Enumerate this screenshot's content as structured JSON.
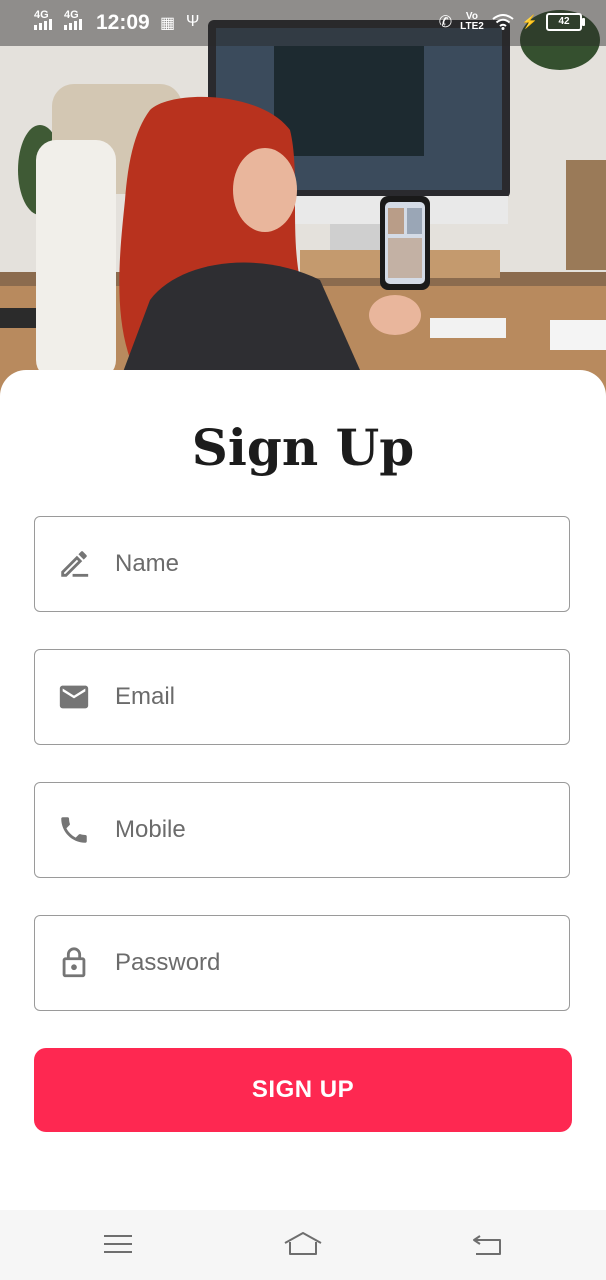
{
  "status_bar": {
    "network_1": "4G",
    "network_2": "4G",
    "time": "12:09",
    "lte_top": "Vo",
    "lte_bottom": "LTE2",
    "battery": "42",
    "icons": [
      "signal-icon",
      "signal-icon",
      "data-saver-icon",
      "usb-icon",
      "volte-icon",
      "wifi-icon",
      "charging-icon",
      "battery-icon"
    ]
  },
  "hero_image": {
    "description_icon": "hero-photo"
  },
  "form": {
    "title": "Sign Up",
    "fields": [
      {
        "placeholder": "Name",
        "icon": "pencil-icon"
      },
      {
        "placeholder": "Email",
        "icon": "email-icon"
      },
      {
        "placeholder": "Mobile",
        "icon": "phone-icon"
      },
      {
        "placeholder": "Password",
        "icon": "lock-icon"
      }
    ],
    "submit_label": "SIGN UP"
  },
  "colors": {
    "accent": "#fe2851",
    "field_border": "#9a9a9a",
    "icon_gray": "#757575",
    "title": "#1c1c1c"
  },
  "nav_bar": {
    "icons": [
      "menu-icon",
      "home-icon",
      "back-icon"
    ]
  }
}
